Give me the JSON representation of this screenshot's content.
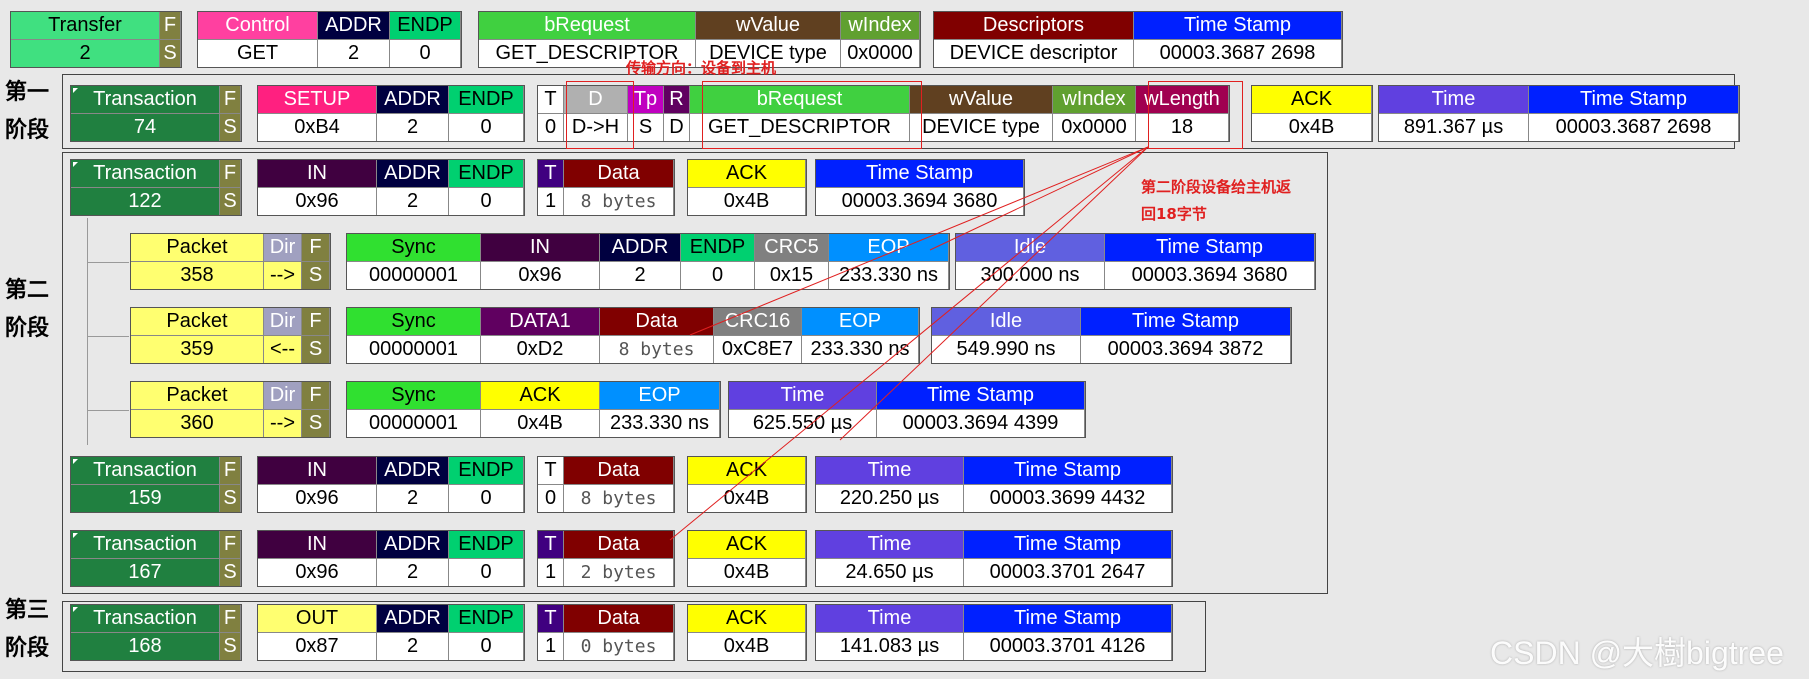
{
  "colors": {
    "transfer": "#40e080",
    "control": "#ff40a0",
    "addr": "#000040",
    "endp": "#00d070",
    "flag": "#808040",
    "brequest": "#40d040",
    "wvalue": "#604020",
    "windex": "#60a030",
    "descriptors": "#800000",
    "timestamp": "#0020ff",
    "transaction": "#208040",
    "setup": "#ff2080",
    "d": "#b0b0b0",
    "tp": "#c000c0",
    "r": "#600060",
    "wlength": "#a00050",
    "ack": "#ffff00",
    "time": "#6040e0",
    "in": "#400040",
    "t": "#400080",
    "data": "#800000",
    "packet": "#ffff70",
    "dir": "#a0a0c0",
    "sync": "#30e030",
    "crc": "#808080",
    "eop": "#0090ff",
    "idle": "#6060e0",
    "data1": "#600060",
    "out": "#ffff70",
    "note_red": "#e02020"
  },
  "transfer_row": {
    "transfer": {
      "label": "Transfer",
      "value": "2"
    },
    "f": "F",
    "s": "S",
    "control": {
      "label": "Control",
      "value": "GET"
    },
    "addr": {
      "label": "ADDR",
      "value": "2"
    },
    "endp": {
      "label": "ENDP",
      "value": "0"
    },
    "brequest": {
      "label": "bRequest",
      "value": "GET_DESCRIPTOR"
    },
    "wvalue": {
      "label": "wValue",
      "value": "DEVICE type"
    },
    "windex": {
      "label": "wIndex",
      "value": "0x0000"
    },
    "descriptors": {
      "label": "Descriptors",
      "value": "DEVICE descriptor"
    },
    "timestamp": {
      "label": "Time Stamp",
      "value": "00003.3687 2698"
    }
  },
  "stages": {
    "stage1": [
      "第一",
      "阶段"
    ],
    "stage2": [
      "第二",
      "阶段"
    ],
    "stage3": [
      "第三",
      "阶段"
    ]
  },
  "annotations": {
    "direction": "传输方向：设备到主机",
    "stage2_note": [
      "第二阶段设备给主机返",
      "回18字节"
    ]
  },
  "setup_row": {
    "transaction": {
      "label": "Transaction",
      "value": "74"
    },
    "f": "F",
    "s": "S",
    "setup": {
      "label": "SETUP",
      "value": "0xB4"
    },
    "addr": {
      "label": "ADDR",
      "value": "2"
    },
    "endp": {
      "label": "ENDP",
      "value": "0"
    },
    "t": {
      "label": "T",
      "value": "0"
    },
    "d": {
      "label": "D",
      "value": "D->H"
    },
    "tp": {
      "label": "Tp",
      "value": "S"
    },
    "r": {
      "label": "R",
      "value": "D"
    },
    "brequest": {
      "label": "bRequest",
      "value": "GET_DESCRIPTOR"
    },
    "wvalue": {
      "label": "wValue",
      "value": "DEVICE type"
    },
    "windex": {
      "label": "wIndex",
      "value": "0x0000"
    },
    "wlength": {
      "label": "wLength",
      "value": "18"
    },
    "ack": {
      "label": "ACK",
      "value": "0x4B"
    },
    "time": {
      "label": "Time",
      "value": "891.367 µs"
    },
    "timestamp": {
      "label": "Time Stamp",
      "value": "00003.3687 2698"
    }
  },
  "in_txn_122": {
    "transaction": {
      "label": "Transaction",
      "value": "122"
    },
    "f": "F",
    "s": "S",
    "in": {
      "label": "IN",
      "value": "0x96"
    },
    "addr": {
      "label": "ADDR",
      "value": "2"
    },
    "endp": {
      "label": "ENDP",
      "value": "0"
    },
    "t": {
      "label": "T",
      "value": "1"
    },
    "data": {
      "label": "Data",
      "value": "8 bytes"
    },
    "ack": {
      "label": "ACK",
      "value": "0x4B"
    },
    "timestamp": {
      "label": "Time Stamp",
      "value": "00003.3694 3680"
    }
  },
  "packet_358": {
    "packet": {
      "label": "Packet",
      "value": "358"
    },
    "dir": {
      "label": "Dir",
      "value": "-->"
    },
    "f": "F",
    "s": "S",
    "sync": {
      "label": "Sync",
      "value": "00000001"
    },
    "in": {
      "label": "IN",
      "value": "0x96"
    },
    "addr": {
      "label": "ADDR",
      "value": "2"
    },
    "endp": {
      "label": "ENDP",
      "value": "0"
    },
    "crc5": {
      "label": "CRC5",
      "value": "0x15"
    },
    "eop": {
      "label": "EOP",
      "value": "233.330 ns"
    },
    "idle": {
      "label": "Idle",
      "value": "300.000 ns"
    },
    "timestamp": {
      "label": "Time Stamp",
      "value": "00003.3694 3680"
    }
  },
  "packet_359": {
    "packet": {
      "label": "Packet",
      "value": "359"
    },
    "dir": {
      "label": "Dir",
      "value": "<--"
    },
    "f": "F",
    "s": "S",
    "sync": {
      "label": "Sync",
      "value": "00000001"
    },
    "data1": {
      "label": "DATA1",
      "value": "0xD2"
    },
    "data": {
      "label": "Data",
      "value": "8 bytes"
    },
    "crc16": {
      "label": "CRC16",
      "value": "0xC8E7"
    },
    "eop": {
      "label": "EOP",
      "value": "233.330 ns"
    },
    "idle": {
      "label": "Idle",
      "value": "549.990 ns"
    },
    "timestamp": {
      "label": "Time Stamp",
      "value": "00003.3694 3872"
    }
  },
  "packet_360": {
    "packet": {
      "label": "Packet",
      "value": "360"
    },
    "dir": {
      "label": "Dir",
      "value": "-->"
    },
    "f": "F",
    "s": "S",
    "sync": {
      "label": "Sync",
      "value": "00000001"
    },
    "ack": {
      "label": "ACK",
      "value": "0x4B"
    },
    "eop": {
      "label": "EOP",
      "value": "233.330 ns"
    },
    "time": {
      "label": "Time",
      "value": "625.550 µs"
    },
    "timestamp": {
      "label": "Time Stamp",
      "value": "00003.3694 4399"
    }
  },
  "in_txn_159": {
    "transaction": {
      "label": "Transaction",
      "value": "159"
    },
    "f": "F",
    "s": "S",
    "in": {
      "label": "IN",
      "value": "0x96"
    },
    "addr": {
      "label": "ADDR",
      "value": "2"
    },
    "endp": {
      "label": "ENDP",
      "value": "0"
    },
    "t": {
      "label": "T",
      "value": "0"
    },
    "data": {
      "label": "Data",
      "value": "8 bytes"
    },
    "ack": {
      "label": "ACK",
      "value": "0x4B"
    },
    "time": {
      "label": "Time",
      "value": "220.250 µs"
    },
    "timestamp": {
      "label": "Time Stamp",
      "value": "00003.3699 4432"
    }
  },
  "in_txn_167": {
    "transaction": {
      "label": "Transaction",
      "value": "167"
    },
    "f": "F",
    "s": "S",
    "in": {
      "label": "IN",
      "value": "0x96"
    },
    "addr": {
      "label": "ADDR",
      "value": "2"
    },
    "endp": {
      "label": "ENDP",
      "value": "0"
    },
    "t": {
      "label": "T",
      "value": "1"
    },
    "data": {
      "label": "Data",
      "value": "2 bytes"
    },
    "ack": {
      "label": "ACK",
      "value": "0x4B"
    },
    "time": {
      "label": "Time",
      "value": "24.650 µs"
    },
    "timestamp": {
      "label": "Time Stamp",
      "value": "00003.3701 2647"
    }
  },
  "out_txn_168": {
    "transaction": {
      "label": "Transaction",
      "value": "168"
    },
    "f": "F",
    "s": "S",
    "out": {
      "label": "OUT",
      "value": "0x87"
    },
    "addr": {
      "label": "ADDR",
      "value": "2"
    },
    "endp": {
      "label": "ENDP",
      "value": "0"
    },
    "t": {
      "label": "T",
      "value": "1"
    },
    "data": {
      "label": "Data",
      "value": "0 bytes"
    },
    "ack": {
      "label": "ACK",
      "value": "0x4B"
    },
    "time": {
      "label": "Time",
      "value": "141.083 µs"
    },
    "timestamp": {
      "label": "Time Stamp",
      "value": "00003.3701 4126"
    }
  },
  "watermark": "CSDN @大樹bigtree"
}
